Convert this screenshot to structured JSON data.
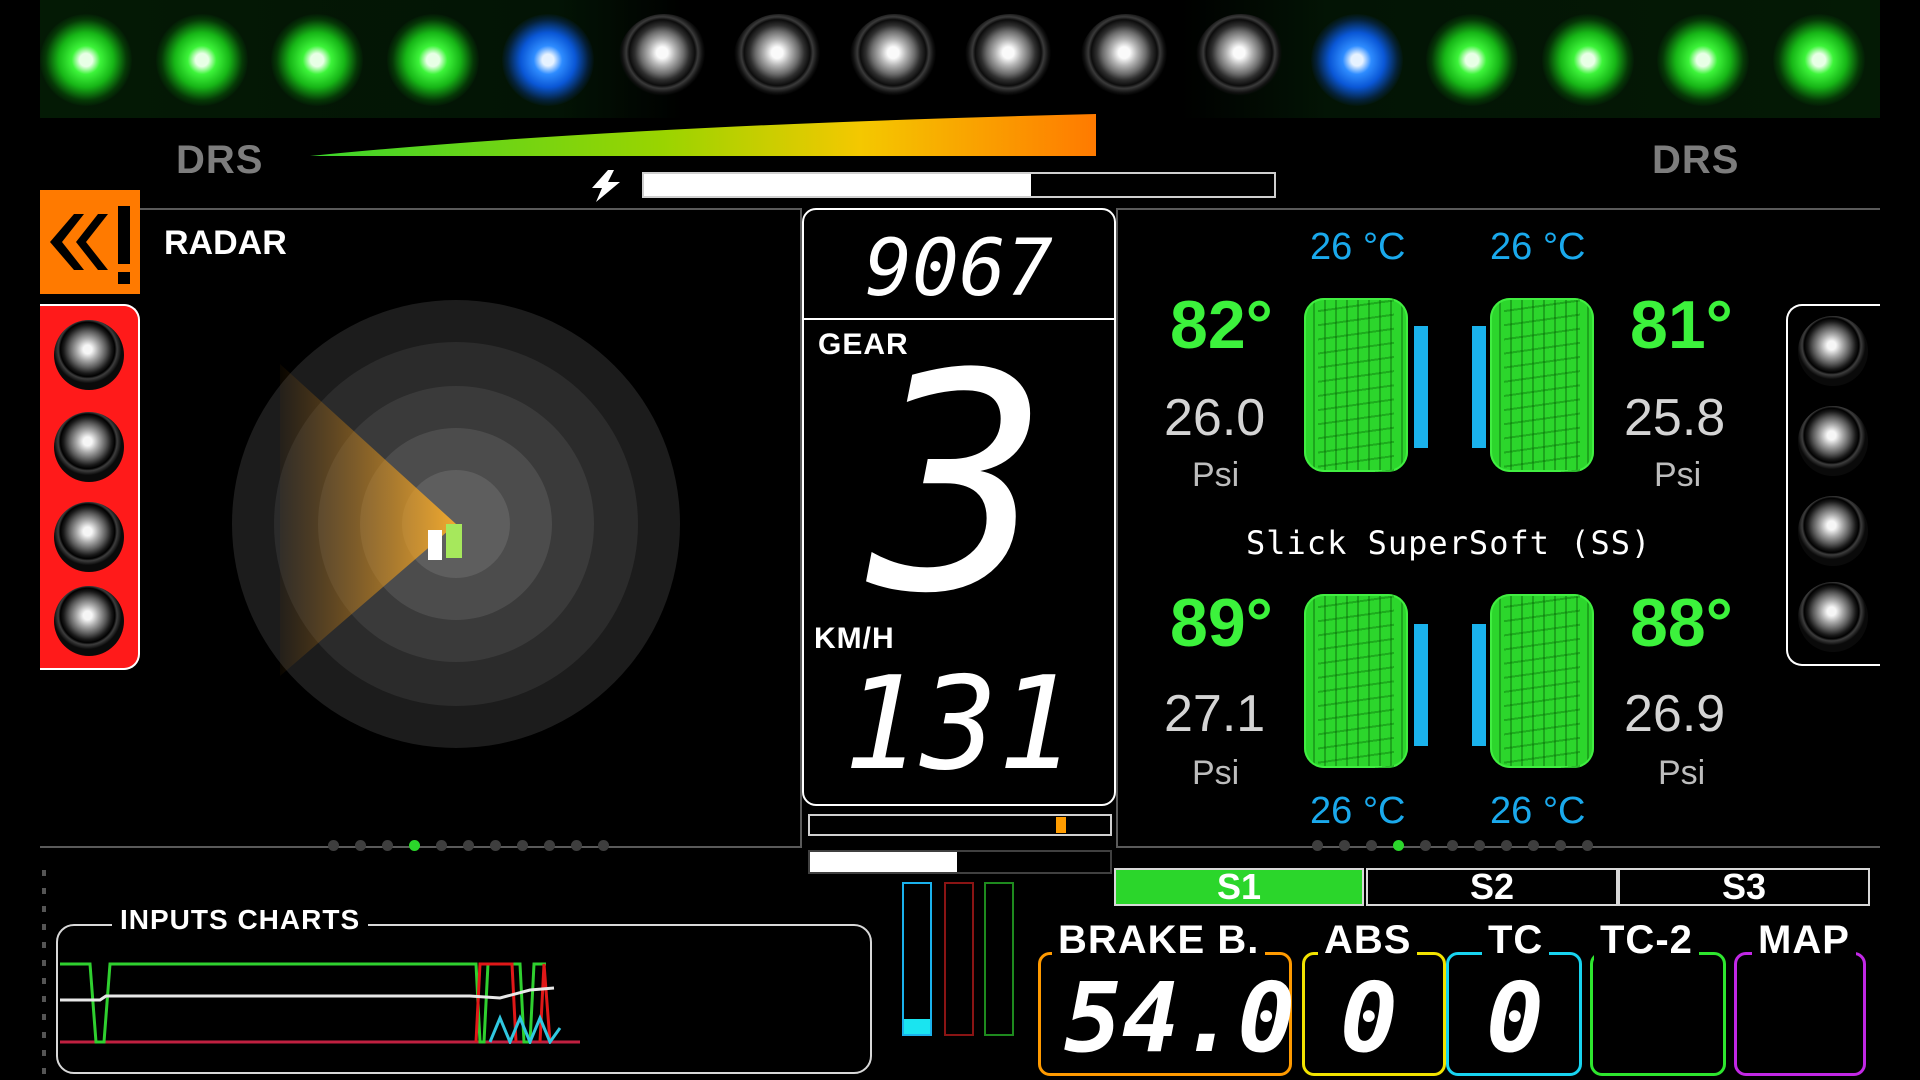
{
  "leds": [
    "green",
    "green",
    "green",
    "green",
    "blue",
    "off",
    "off",
    "off",
    "off",
    "off",
    "off",
    "blue",
    "green",
    "green",
    "green",
    "green"
  ],
  "drs": {
    "left_label": "DRS",
    "right_label": "DRS"
  },
  "radar": {
    "title": "RADAR",
    "warning_icon": "chevron-warning-icon"
  },
  "center": {
    "rpm": "9067",
    "gear_label": "GEAR",
    "gear": "3",
    "speed_label": "KM/H",
    "speed": "131"
  },
  "tyres": {
    "compound": "Slick SuperSoft (SS)",
    "fl": {
      "core": "26 °C",
      "temp": "82°",
      "psi": "26.0",
      "unit": "Psi"
    },
    "fr": {
      "core": "26 °C",
      "temp": "81°",
      "psi": "25.8",
      "unit": "Psi"
    },
    "rl": {
      "core": "26 °C",
      "temp": "89°",
      "psi": "27.1",
      "unit": "Psi"
    },
    "rr": {
      "core": "26 °C",
      "temp": "88°",
      "psi": "26.9",
      "unit": "Psi"
    }
  },
  "inputs": {
    "title": "INPUTS CHARTS"
  },
  "sectors": [
    {
      "label": "S1",
      "active": true
    },
    {
      "label": "S2",
      "active": false
    },
    {
      "label": "S3",
      "active": false
    }
  ],
  "settings": {
    "brake_label": "BRAKE B.",
    "brake_value": "54.0",
    "abs_label": "ABS",
    "abs_value": "0",
    "tc_label": "TC",
    "tc_value": "0",
    "tc2_label": "TC-2",
    "tc2_value": "",
    "map_label": "MAP",
    "map_value": ""
  },
  "colors": {
    "green": "#3cf23c",
    "blue": "#1aa9ec",
    "orange": "#ff7a00",
    "red": "#ff1a1a",
    "brake_border": "#ff9a00",
    "abs_border": "#f2e300",
    "tc_border": "#18d4f0",
    "tc2_border": "#2ee62e",
    "map_border": "#c228e6"
  }
}
